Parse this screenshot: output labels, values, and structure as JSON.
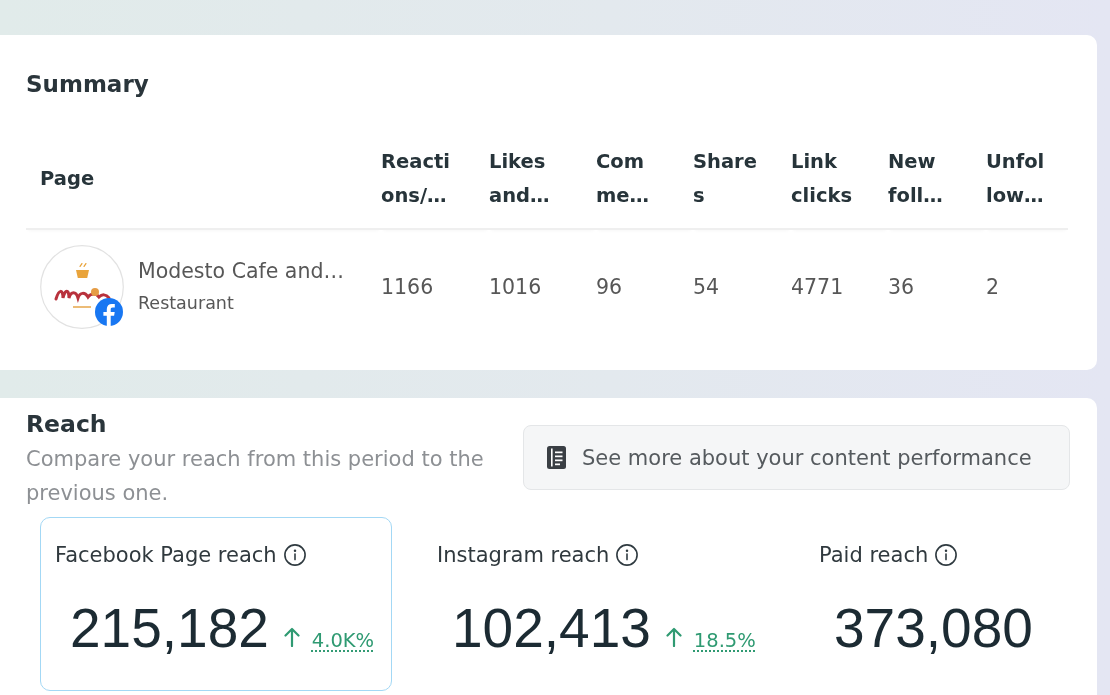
{
  "summary": {
    "title": "Summary",
    "table": {
      "page_header": "Page",
      "columns": [
        "Reacti\nons/…",
        "Likes\nand…",
        "Com\nme…",
        "Share\ns",
        "Link\nclicks",
        "New\nfoll…",
        "Unfol\nlow…"
      ],
      "rows": [
        {
          "page": {
            "name": "Modesto Cafe and…",
            "category": "Restaurant",
            "kind": "facebook"
          },
          "cells": [
            "1166",
            "1016",
            "96",
            "54",
            "4771",
            "36",
            "2"
          ]
        }
      ]
    }
  },
  "reach": {
    "title": "Reach",
    "subtitle": "Compare your reach from this period to the previous one.",
    "button": {
      "label": "See more about your content performance"
    },
    "metrics": [
      {
        "label": "Facebook Page reach",
        "value": "215,182",
        "selected": true,
        "change": {
          "kind": "up",
          "value": "4.0K%"
        }
      },
      {
        "label": "Instagram reach",
        "value": "102,413",
        "selected": false,
        "change": {
          "kind": "up",
          "value": "18.5%"
        }
      },
      {
        "label": "Paid reach",
        "value": "373,080",
        "selected": false
      }
    ]
  }
}
